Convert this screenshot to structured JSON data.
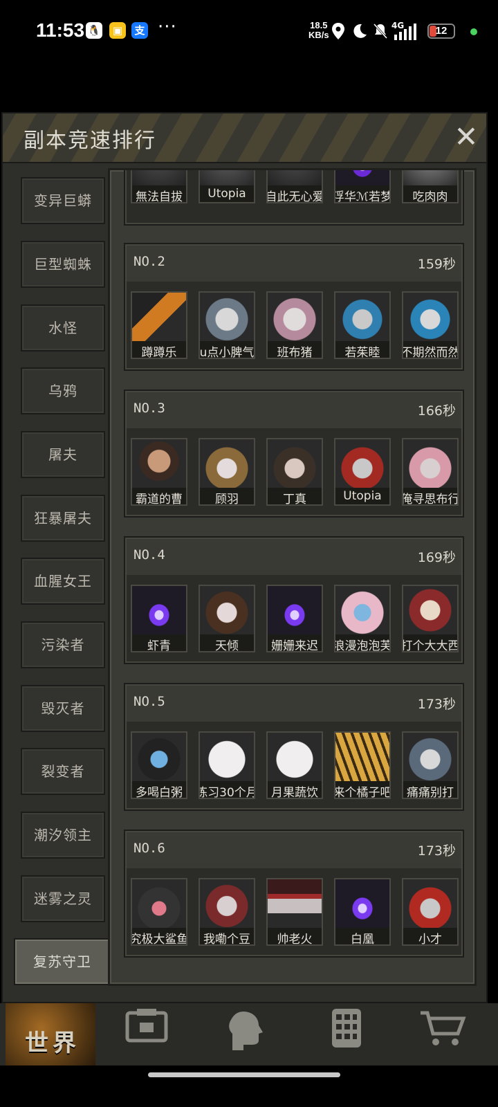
{
  "status_bar": {
    "time": "11:53",
    "speed_value": "18.5",
    "speed_unit": "KB/s",
    "network": "4G",
    "battery": "12",
    "apps": [
      "qq-icon",
      "wallet-icon",
      "alipay-icon"
    ],
    "more": "···"
  },
  "panel": {
    "title": "副本竞速排行",
    "close_label": "✕"
  },
  "sidebar": {
    "items": [
      {
        "label": "变异巨蟒"
      },
      {
        "label": "巨型蜘蛛"
      },
      {
        "label": "水怪"
      },
      {
        "label": "乌鸦"
      },
      {
        "label": "屠夫"
      },
      {
        "label": "狂暴屠夫"
      },
      {
        "label": "血腥女王"
      },
      {
        "label": "污染者"
      },
      {
        "label": "毁灭者"
      },
      {
        "label": "裂变者"
      },
      {
        "label": "潮汐领主"
      },
      {
        "label": "迷雾之灵"
      },
      {
        "label": "复苏守卫"
      }
    ],
    "active_index": 12
  },
  "rankings": [
    {
      "no": "",
      "time": "",
      "players": [
        "無法自拔",
        "Utopia",
        "自此无心爱",
        "浮华ℳ若梦",
        "吃肉肉"
      ]
    },
    {
      "no": "NO.2",
      "time": "159秒",
      "players": [
        "蹲蹲乐",
        "u点小脾气",
        "班布猪",
        "若茱睦",
        "不期然而然"
      ]
    },
    {
      "no": "NO.3",
      "time": "166秒",
      "players": [
        "霸道的曹",
        "顾羽",
        "丁真",
        "Utopia",
        "俺寻思布行"
      ]
    },
    {
      "no": "NO.4",
      "time": "169秒",
      "players": [
        "虾青",
        "天倾",
        "姗姗来迟",
        "浪漫泡泡芙",
        "打个大大西"
      ]
    },
    {
      "no": "NO.5",
      "time": "173秒",
      "players": [
        "多喝白粥",
        "练习30个月",
        "月果蔬饮",
        "来个橘子吧",
        "痛痛别打"
      ]
    },
    {
      "no": "NO.6",
      "time": "173秒",
      "players": [
        "究极大鲨鱼",
        "我嘞个豆",
        "帅老火",
        "白凰",
        "小才"
      ]
    }
  ],
  "bottom_nav": {
    "world_label": "世界",
    "items": [
      "world",
      "backpack-icon",
      "character-icon",
      "phone-icon",
      "cart-icon"
    ]
  }
}
